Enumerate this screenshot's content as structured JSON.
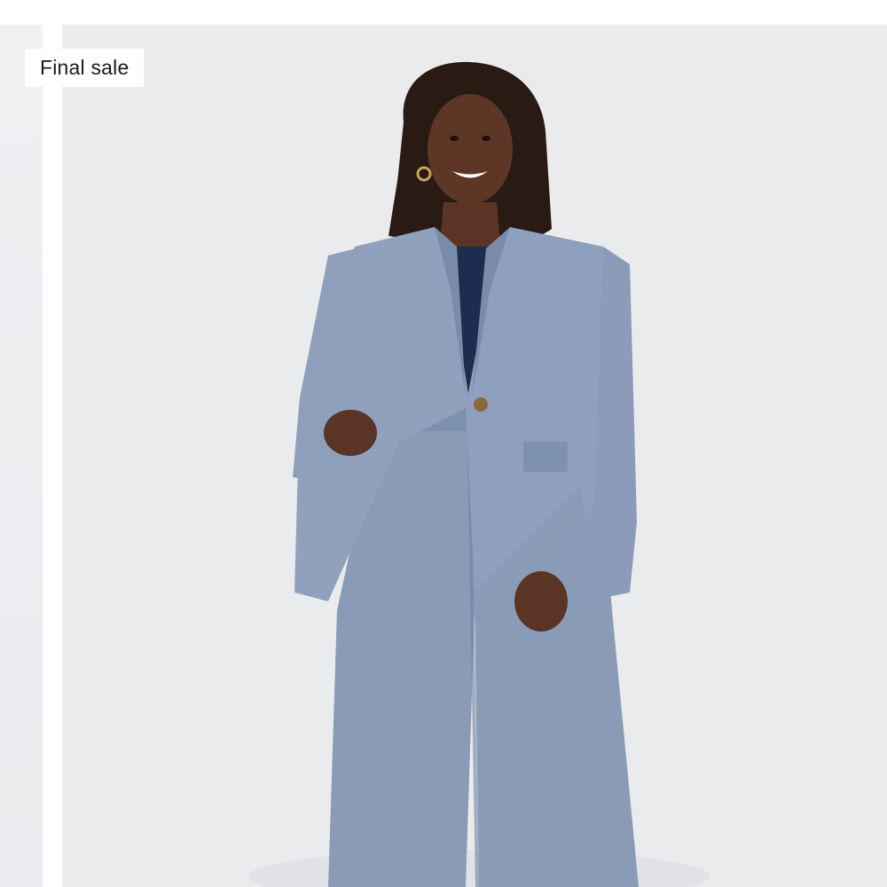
{
  "badge": {
    "label": "Final sale"
  },
  "product_image": {
    "subject": "model-in-chambray-linen-blazer-and-wide-leg-pants",
    "colors": {
      "background": "#e9eaec",
      "suit": "#8fa0bd",
      "suit_shadow": "#6f82a3",
      "top": "#1f2c52",
      "skin": "#5a3424",
      "hair": "#2a1a14"
    }
  }
}
